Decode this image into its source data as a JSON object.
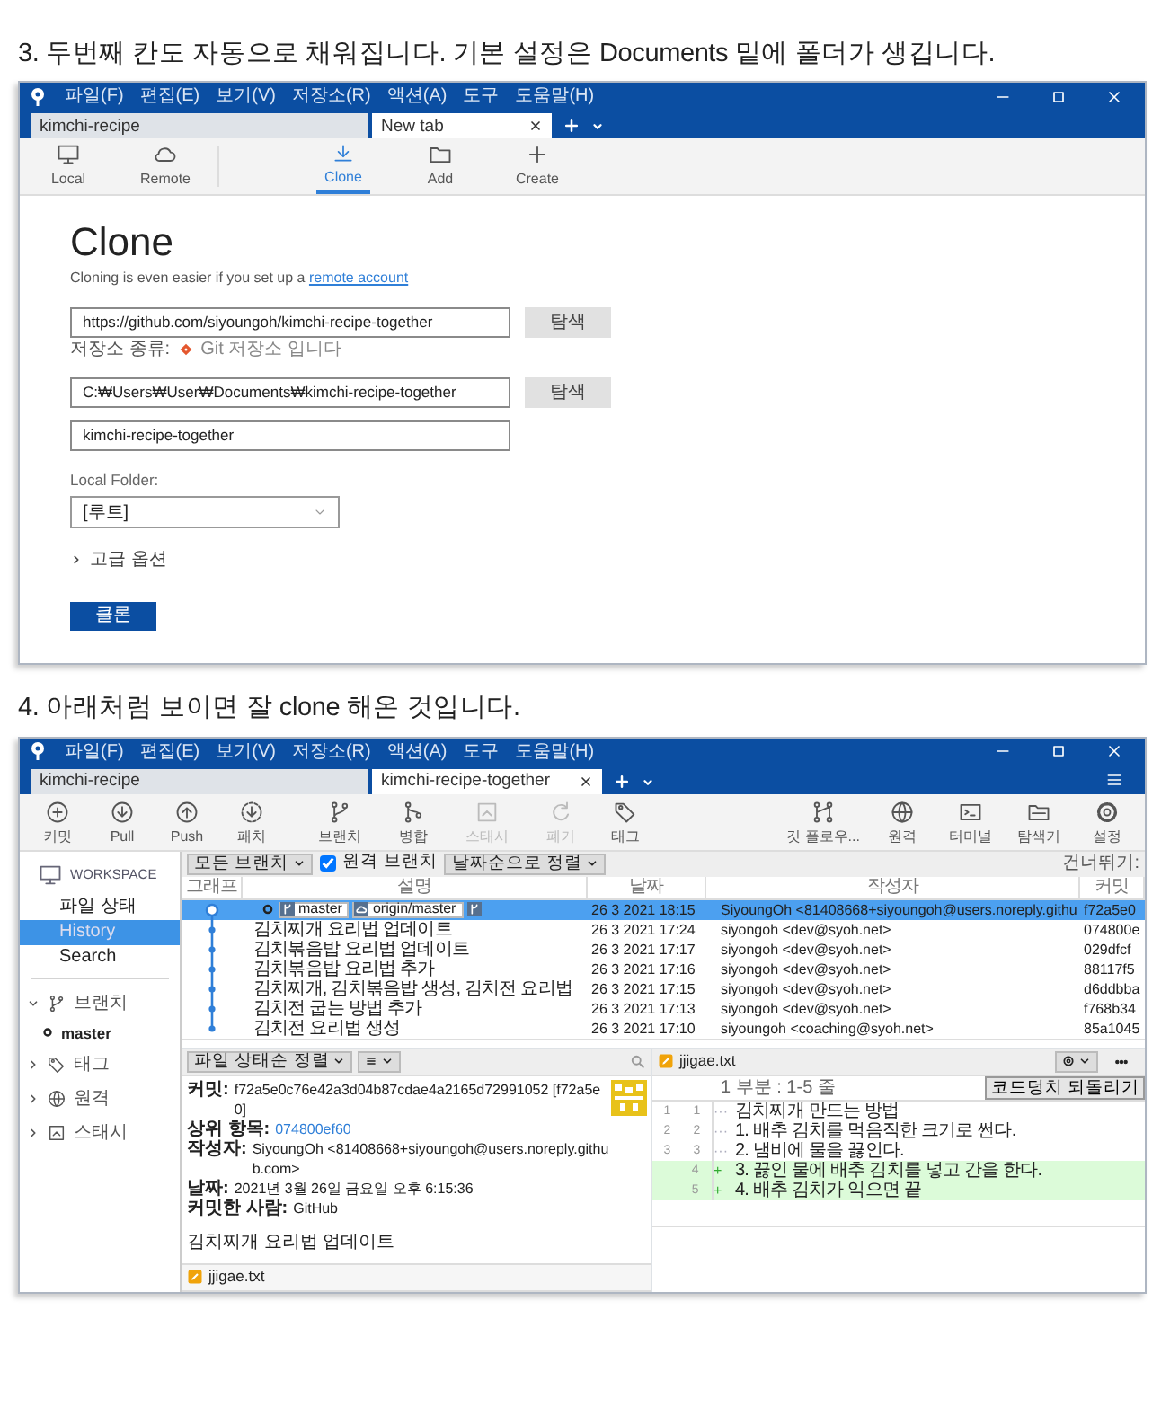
{
  "clone_step": {
    "heading": "3. 두번째 칸도 자동으로 채워집니다. 기본 설정은 Documents 밑에 폴더가 생깁니다.",
    "menu": [
      "파일(F)",
      "편집(E)",
      "보기(V)",
      "저장소(R)",
      "액션(A)",
      "도구",
      "도움말(H)"
    ],
    "tabs": [
      {
        "label": "kimchi-recipe",
        "selected": false,
        "closable": false
      },
      {
        "label": "New tab",
        "selected": true,
        "closable": true
      }
    ],
    "toolbar_groups": [
      {
        "items": [
          {
            "kind": "monitor",
            "label": "Local",
            "selected": false
          },
          {
            "kind": "cloud",
            "label": "Remote",
            "selected": false
          }
        ]
      },
      {
        "items": [
          {
            "kind": "download",
            "label": "Clone",
            "selected": true
          },
          {
            "kind": "folder",
            "label": "Add",
            "selected": false
          },
          {
            "kind": "plus",
            "label": "Create",
            "selected": false
          }
        ]
      }
    ],
    "title": "Clone",
    "subtitle": "Cloning is even easier if you set up a ",
    "subtitle_link": "remote account",
    "source": {
      "value": "https://github.com/siyoungoh/kimchi-recipe-together",
      "button": "탐색"
    },
    "repo_type": {
      "label": "저장소 종류:",
      "value": "Git 저장소 입니다"
    },
    "destination": {
      "value": "C:₩Users₩User₩Documents₩kimchi-recipe-together",
      "button": "탐색"
    },
    "name": {
      "value": "kimchi-recipe-together"
    },
    "local_folder": {
      "label": "Local Folder:",
      "value": "[루트]"
    },
    "advanced": {
      "label": "고급 옵션",
      "expanded": false
    },
    "submit": "클론"
  },
  "history_step": {
    "heading": "4. 아래처럼 보이면 잘 clone 해온 것입니다.",
    "menu": [
      "파일(F)",
      "편집(E)",
      "보기(V)",
      "저장소(R)",
      "액션(A)",
      "도구",
      "도움말(H)"
    ],
    "menu_button": true,
    "tabs": [
      {
        "label": "kimchi-recipe",
        "selected": false,
        "closable": false
      },
      {
        "label": "kimchi-recipe-together",
        "selected": true,
        "closable": true
      }
    ],
    "toolbar": {
      "left": [
        {
          "kind": "commit",
          "label": "커밋",
          "disabled": false
        },
        {
          "kind": "pull",
          "label": "Pull",
          "disabled": false
        },
        {
          "kind": "push",
          "label": "Push",
          "disabled": false
        },
        {
          "kind": "fetch",
          "label": "패치",
          "disabled": false
        },
        {
          "kind": "branch",
          "label": "브랜치",
          "disabled": false
        },
        {
          "kind": "merge",
          "label": "병합",
          "disabled": false
        },
        {
          "kind": "stash",
          "label": "스태시",
          "disabled": true
        },
        {
          "kind": "discard",
          "label": "폐기",
          "disabled": true
        },
        {
          "kind": "tag",
          "label": "태그",
          "disabled": false
        }
      ],
      "right": [
        {
          "kind": "gitflow",
          "label": "깃 플로우...",
          "disabled": false
        },
        {
          "kind": "globe",
          "label": "원격",
          "disabled": false
        },
        {
          "kind": "terminal",
          "label": "터미널",
          "disabled": false
        },
        {
          "kind": "explorer",
          "label": "탐색기",
          "disabled": false
        },
        {
          "kind": "gear",
          "label": "설정",
          "disabled": false
        }
      ]
    },
    "sidebar": {
      "workspace": "WORKSPACE",
      "items": [
        {
          "label": "파일 상태",
          "selected": false
        },
        {
          "label": "History",
          "selected": true
        },
        {
          "label": "Search",
          "selected": false
        }
      ],
      "groups": [
        {
          "kind": "branch",
          "label": "브랜치",
          "expanded": true,
          "children": [
            {
              "label": "master",
              "current": true
            }
          ]
        },
        {
          "kind": "tag",
          "label": "태그",
          "expanded": false
        },
        {
          "kind": "globe",
          "label": "원격",
          "expanded": false
        },
        {
          "kind": "stash",
          "label": "스태시",
          "expanded": false
        }
      ]
    },
    "filters": {
      "branches": "모든 브랜치",
      "remote_branches": {
        "label": "원격 브랜치",
        "checked": true
      },
      "sort": "날짜순으로 정렬",
      "skip_label": "건너뛰기:"
    },
    "columns": [
      "그래프",
      "설명",
      "날짜",
      "작성자",
      "커밋"
    ],
    "rows": [
      {
        "selected": true,
        "head": true,
        "tags": [
          {
            "kind": "local",
            "label": "master"
          },
          {
            "kind": "remote",
            "label": "origin/master"
          },
          {
            "kind": "overflow"
          }
        ],
        "date": "26 3 2021 18:15",
        "author": "SiyoungOh <81408668+siyoungoh@users.noreply.githu",
        "commit": "f72a5e0"
      },
      {
        "selected": false,
        "head": false,
        "description": "김치찌개 요리법 업데이트",
        "date": "26 3 2021 17:24",
        "author": "siyongoh <dev@syoh.net>",
        "commit": "074800e"
      },
      {
        "selected": false,
        "head": false,
        "description": "김치볶음밥 요리법 업데이트",
        "date": "26 3 2021 17:17",
        "author": "siyongoh <dev@syoh.net>",
        "commit": "029dfcf"
      },
      {
        "selected": false,
        "head": false,
        "description": "김치볶음밥 요리법 추가",
        "date": "26 3 2021 17:16",
        "author": "siyongoh <dev@syoh.net>",
        "commit": "88117f5"
      },
      {
        "selected": false,
        "head": false,
        "description": "김치찌개, 김치볶음밥 생성, 김치전 요리법",
        "date": "26 3 2021 17:15",
        "author": "siyongoh <dev@syoh.net>",
        "commit": "d6ddbba"
      },
      {
        "selected": false,
        "head": false,
        "description": "김치전 굽는 방법 추가",
        "date": "26 3 2021 17:13",
        "author": "siyongoh <dev@syoh.net>",
        "commit": "f768b34"
      },
      {
        "selected": false,
        "head": false,
        "description": "김치전 요리법 생성",
        "date": "26 3 2021 17:10",
        "author": "siyoungoh <coaching@syoh.net>",
        "commit": "85a1045"
      }
    ],
    "details": {
      "sort": "파일 상태순 정렬",
      "lines": [
        {
          "label": "커밋:",
          "value": "f72a5e0c76e42a3d04b87cdae4a2165d72991052 [f72a5e0]",
          "kind": "text"
        },
        {
          "label": "상위 항목:",
          "value": "074800ef60",
          "kind": "link"
        },
        {
          "label": "작성자:",
          "value": "SiyoungOh <81408668+siyoungoh@users.noreply.github.com>",
          "kind": "text"
        },
        {
          "label": "날짜:",
          "value": "2021년 3월 26일 금요일 오후 6:15:36",
          "kind": "text"
        },
        {
          "label": "커밋한 사람:",
          "value": "GitHub",
          "kind": "text"
        }
      ],
      "message": "김치찌개 요리법 업데이트",
      "files": [
        {
          "name": "jjigae.txt",
          "modified": true
        }
      ]
    },
    "diff": {
      "file": "jjigae.txt",
      "hunk": "1 부분 : 1-5 줄",
      "revert": "코드덩치 되돌리기",
      "lines": [
        {
          "old": "1",
          "new": "1",
          "marker": "···",
          "text": "김치찌개 만드는 방법",
          "kind": "context"
        },
        {
          "old": "2",
          "new": "2",
          "marker": "···",
          "text": "1. 배추 김치를 먹음직한 크기로 썬다.",
          "kind": "context"
        },
        {
          "old": "3",
          "new": "3",
          "marker": "···",
          "text": "2. 냄비에 물을 끓인다.",
          "kind": "context"
        },
        {
          "new": "4",
          "marker": "+",
          "text": "3. 끓인 물에 배추 김치를 넣고 간을 한다.",
          "kind": "added"
        },
        {
          "new": "5",
          "marker": "+",
          "text": "4. 배추 김치가 익으면 끝",
          "kind": "added"
        }
      ]
    }
  }
}
